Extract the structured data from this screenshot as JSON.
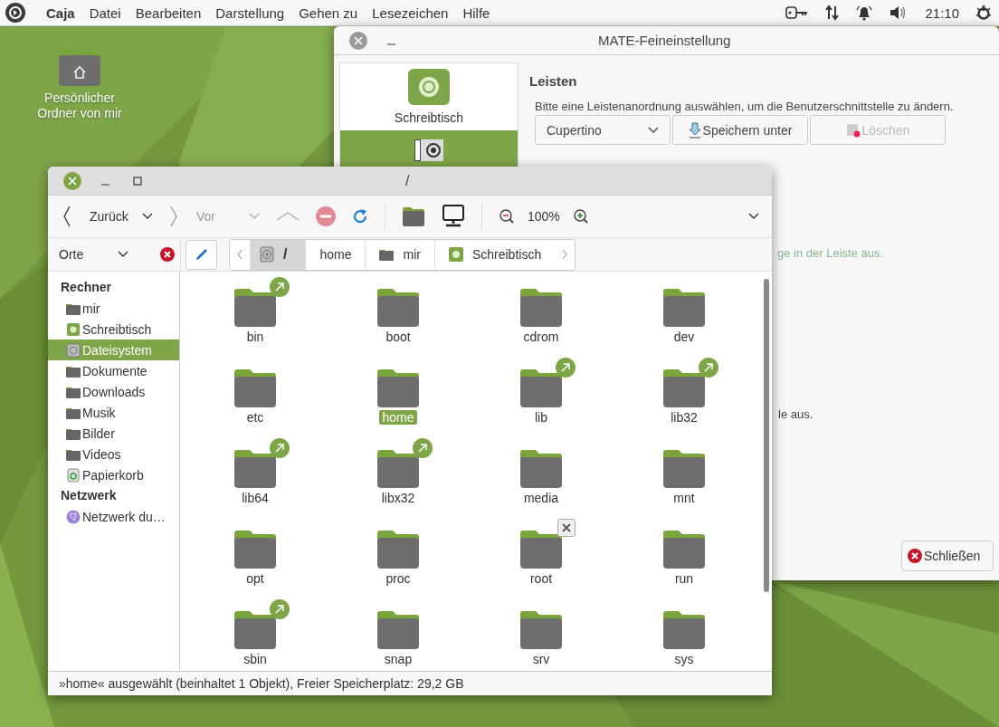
{
  "top_panel": {
    "app": "Caja",
    "menu": [
      "Datei",
      "Bearbeiten",
      "Darstellung",
      "Gehen zu",
      "Lesezeichen",
      "Hilfe"
    ],
    "clock": "21:10"
  },
  "desktop_icons": [
    {
      "label": "Persönlicher Ordner von mir"
    }
  ],
  "tweak_window": {
    "title": "MATE-Feineinstellung",
    "sidebar": [
      {
        "label": "Schreibtisch",
        "selected": false
      },
      {
        "selected": true
      }
    ],
    "heading": "Leisten",
    "description": "Bitte eine Leistenanordnung auswählen, um die Benutzerschnittstelle zu ändern.",
    "layout_combo": {
      "value": "Cupertino"
    },
    "buttons": [
      {
        "label": "Speichern unter",
        "kind": "save",
        "disabled": false
      },
      {
        "label": "Löschen",
        "kind": "delete",
        "disabled": true
      }
    ],
    "partial_texts": [
      {
        "text": "ge in der Leiste aus.",
        "disabled": true
      },
      {
        "text": "le aus.",
        "disabled": false
      }
    ],
    "close_button": "Schließen"
  },
  "file_window": {
    "title": "/",
    "toolbar": {
      "back": "Zurück",
      "forward": "Vor",
      "zoom": "100%"
    },
    "places_combo": "Orte",
    "path": [
      {
        "label": "/",
        "kind": "drive",
        "selected": true
      },
      {
        "label": "home",
        "kind": "none",
        "selected": false
      },
      {
        "label": "mir",
        "kind": "folder",
        "selected": false
      },
      {
        "label": "Schreibtisch",
        "kind": "desktop",
        "selected": false
      }
    ],
    "sidebar": [
      {
        "heading": "Rechner",
        "items": [
          {
            "label": "mir",
            "kind": "folder",
            "selected": false
          },
          {
            "label": "Schreibtisch",
            "kind": "desktop",
            "selected": false
          },
          {
            "label": "Dateisystem",
            "kind": "drive",
            "selected": true
          },
          {
            "label": "Dokumente",
            "kind": "folder",
            "selected": false
          },
          {
            "label": "Downloads",
            "kind": "folder",
            "selected": false
          },
          {
            "label": "Musik",
            "kind": "folder",
            "selected": false
          },
          {
            "label": "Bilder",
            "kind": "folder",
            "selected": false
          },
          {
            "label": "Videos",
            "kind": "folder",
            "selected": false
          },
          {
            "label": "Papierkorb",
            "kind": "trash",
            "selected": false
          }
        ]
      },
      {
        "heading": "Netzwerk",
        "items": [
          {
            "label": "Netzwerk du…",
            "kind": "network",
            "selected": false
          }
        ]
      }
    ],
    "files": [
      {
        "name": "bin",
        "symlink": true,
        "no_access": false,
        "selected": false
      },
      {
        "name": "boot",
        "symlink": false,
        "no_access": false,
        "selected": false
      },
      {
        "name": "cdrom",
        "symlink": false,
        "no_access": false,
        "selected": false
      },
      {
        "name": "dev",
        "symlink": false,
        "no_access": false,
        "selected": false
      },
      {
        "name": "etc",
        "symlink": false,
        "no_access": false,
        "selected": false
      },
      {
        "name": "home",
        "symlink": false,
        "no_access": false,
        "selected": true
      },
      {
        "name": "lib",
        "symlink": true,
        "no_access": false,
        "selected": false
      },
      {
        "name": "lib32",
        "symlink": true,
        "no_access": false,
        "selected": false
      },
      {
        "name": "lib64",
        "symlink": true,
        "no_access": false,
        "selected": false
      },
      {
        "name": "libx32",
        "symlink": true,
        "no_access": false,
        "selected": false
      },
      {
        "name": "media",
        "symlink": false,
        "no_access": false,
        "selected": false
      },
      {
        "name": "mnt",
        "symlink": false,
        "no_access": false,
        "selected": false
      },
      {
        "name": "opt",
        "symlink": false,
        "no_access": false,
        "selected": false
      },
      {
        "name": "proc",
        "symlink": false,
        "no_access": false,
        "selected": false
      },
      {
        "name": "root",
        "symlink": false,
        "no_access": true,
        "selected": false
      },
      {
        "name": "run",
        "symlink": false,
        "no_access": false,
        "selected": false
      },
      {
        "name": "sbin",
        "symlink": true,
        "no_access": false,
        "selected": false
      },
      {
        "name": "snap",
        "symlink": false,
        "no_access": false,
        "selected": false
      },
      {
        "name": "srv",
        "symlink": false,
        "no_access": false,
        "selected": false
      },
      {
        "name": "sys",
        "symlink": false,
        "no_access": false,
        "selected": false
      }
    ],
    "status": "»home« ausgewählt (beinhaltet 1 Objekt), Freier Speicherplatz: 29,2 GB"
  }
}
